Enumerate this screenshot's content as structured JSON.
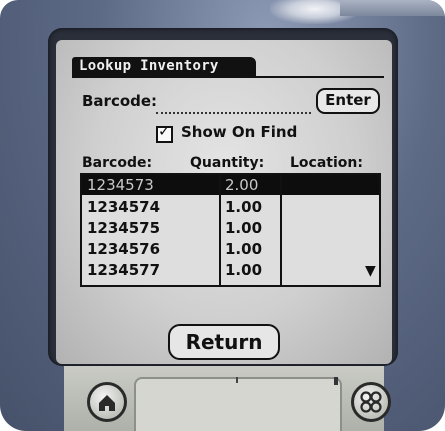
{
  "screen": {
    "title": "Lookup Inventory",
    "barcode_label": "Barcode:",
    "barcode_input": "",
    "enter_label": "Enter",
    "show_on_find_label": "Show On Find",
    "show_on_find_checked": true,
    "columns": [
      "Barcode:",
      "Quantity:",
      "Location:"
    ],
    "rows": [
      {
        "barcode": "1234573",
        "quantity": "2.00",
        "location": "",
        "selected": true
      },
      {
        "barcode": "1234574",
        "quantity": "1.00",
        "location": "",
        "selected": false
      },
      {
        "barcode": "1234575",
        "quantity": "1.00",
        "location": "",
        "selected": false
      },
      {
        "barcode": "1234576",
        "quantity": "1.00",
        "location": "",
        "selected": false
      },
      {
        "barcode": "1234577",
        "quantity": "1.00",
        "location": "",
        "selected": false
      }
    ],
    "return_label": "Return"
  },
  "icons": {
    "check": "check-icon",
    "scroll_down": "scroll-down-arrow-icon",
    "home": "home-icon",
    "apps": "apps-icon"
  }
}
